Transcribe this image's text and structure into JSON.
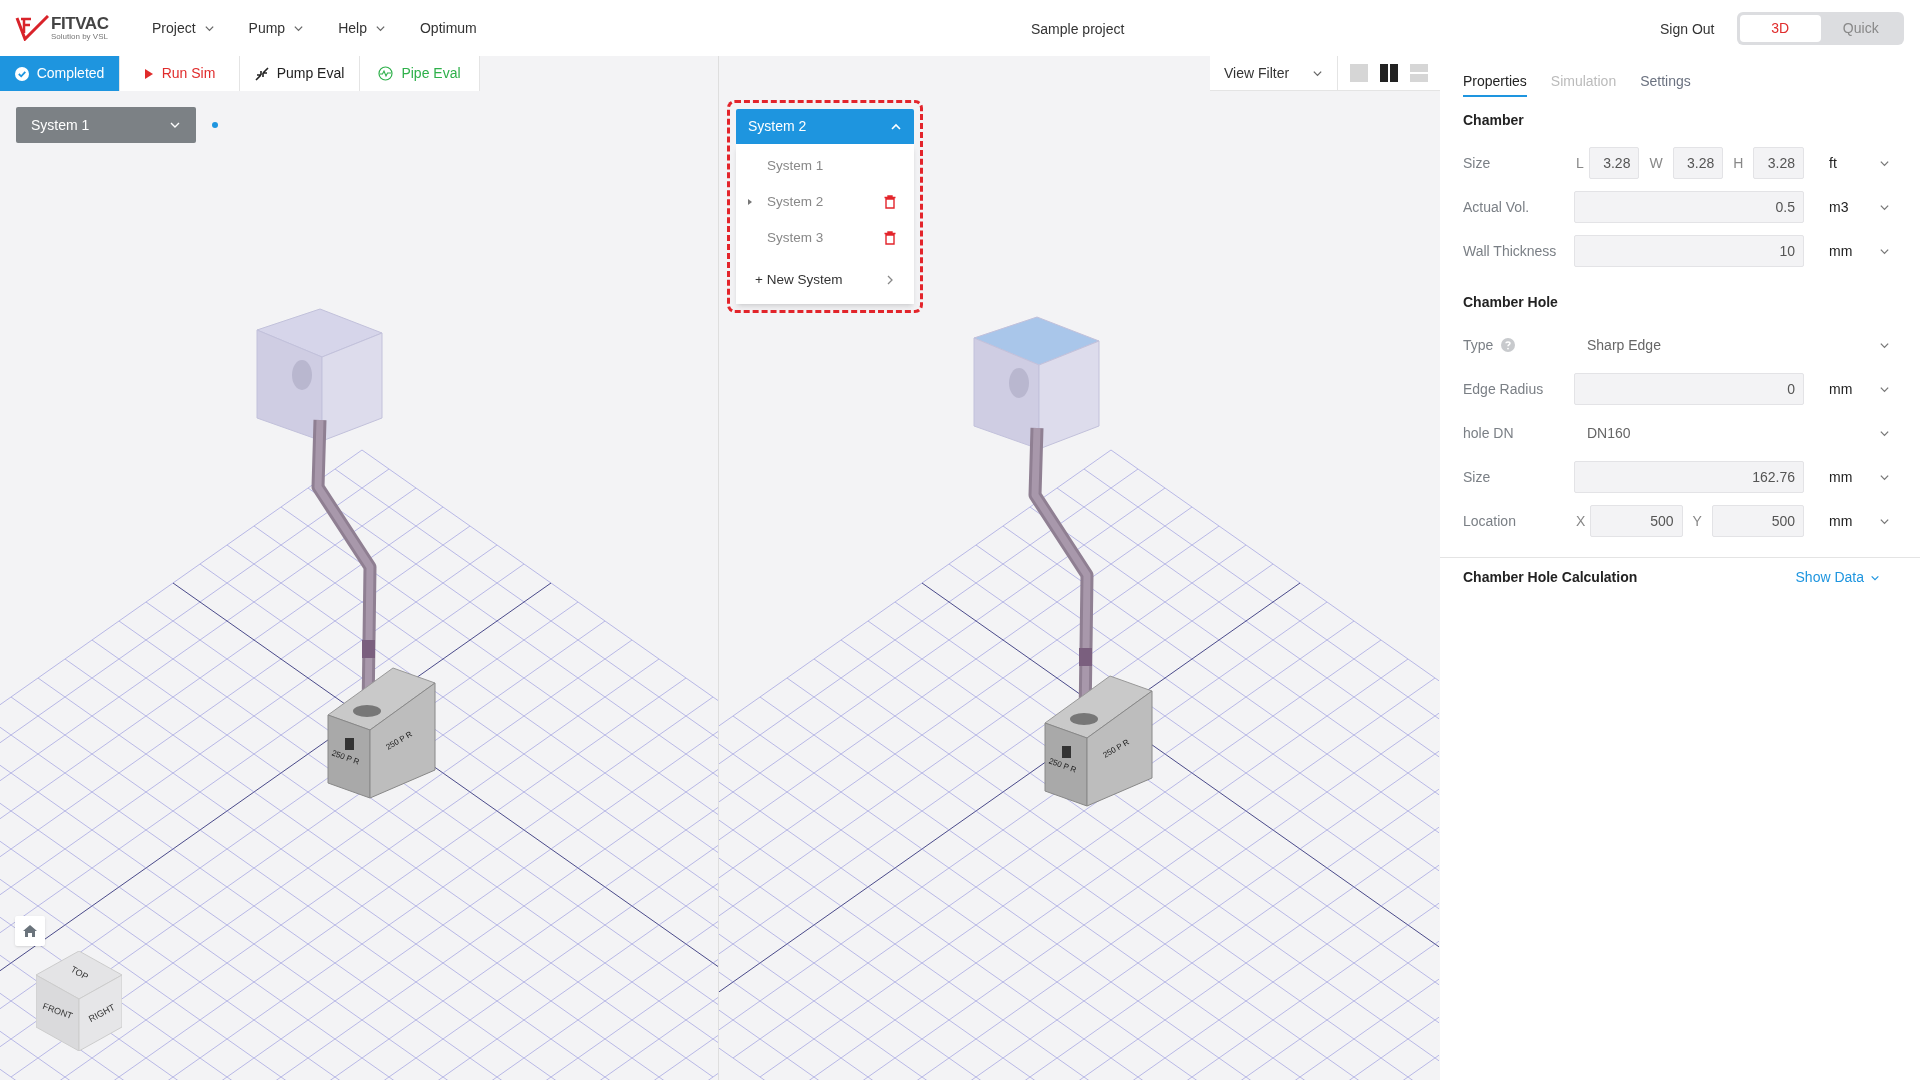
{
  "header": {
    "logo": {
      "name": "FITVAC",
      "tagline": "Solution by VSL"
    },
    "menu": [
      {
        "label": "Project",
        "has_caret": true
      },
      {
        "label": "Pump",
        "has_caret": true
      },
      {
        "label": "Help",
        "has_caret": true
      },
      {
        "label": "Optimum",
        "has_caret": false
      }
    ],
    "project_title": "Sample project",
    "sign_out": "Sign Out",
    "mode_toggle": [
      {
        "label": "3D",
        "selected": true
      },
      {
        "label": "Quick",
        "selected": false
      }
    ]
  },
  "toolbar": [
    {
      "label": "Completed",
      "kind": "status"
    },
    {
      "label": "Run Sim",
      "kind": "run"
    },
    {
      "label": "Pump Eval",
      "kind": "pump"
    },
    {
      "label": "Pipe Eval",
      "kind": "pipe"
    }
  ],
  "left_view": {
    "system_select": "System 1",
    "pump_labels": [
      "250 P R",
      "250 P R"
    ],
    "view_cube": [
      "TOP",
      "FRONT",
      "RIGHT"
    ]
  },
  "right_view": {
    "view_filter": "View Filter",
    "layouts": [
      {
        "kind": "single",
        "selected": false
      },
      {
        "kind": "columns",
        "selected": true
      },
      {
        "kind": "rows",
        "selected": false
      }
    ],
    "system_dropdown": {
      "value": "System 2",
      "expanded": true,
      "items": [
        {
          "label": "System 1",
          "selected": false,
          "deletable": false
        },
        {
          "label": "System 2",
          "selected": true,
          "deletable": true
        },
        {
          "label": "System 3",
          "selected": false,
          "deletable": true
        }
      ],
      "new_item": "+ New System"
    },
    "pump_labels": [
      "250 P R",
      "250 P R"
    ]
  },
  "panel": {
    "tabs": [
      {
        "label": "Properties",
        "selected": true,
        "disabled": false
      },
      {
        "label": "Simulation",
        "selected": false,
        "disabled": true
      },
      {
        "label": "Settings",
        "selected": false,
        "disabled": false
      }
    ],
    "sections": [
      {
        "title": "Chamber",
        "rows": [
          {
            "label": "Size",
            "kind": "multi",
            "fields": [
              {
                "prefix": "L",
                "value": "3.28"
              },
              {
                "prefix": "W",
                "value": "3.28"
              },
              {
                "prefix": "H",
                "value": "3.28"
              }
            ],
            "unit": "ft"
          },
          {
            "label": "Actual Vol.",
            "kind": "input",
            "value": "0.5",
            "unit": "m3"
          },
          {
            "label": "Wall Thickness",
            "kind": "input",
            "value": "10",
            "unit": "mm"
          }
        ]
      },
      {
        "title": "Chamber Hole",
        "rows": [
          {
            "label": "Type",
            "kind": "select",
            "help": true,
            "value": "Sharp Edge"
          },
          {
            "label": "Edge Radius",
            "kind": "input",
            "value": "0",
            "unit": "mm"
          },
          {
            "label": "hole DN",
            "kind": "select",
            "value": "DN160"
          },
          {
            "label": "Size",
            "kind": "input",
            "value": "162.76",
            "unit": "mm"
          },
          {
            "label": "Location",
            "kind": "multi",
            "fields": [
              {
                "prefix": "X",
                "value": "500"
              },
              {
                "prefix": "Y",
                "value": "500"
              }
            ],
            "unit": "mm"
          }
        ]
      }
    ],
    "calculation": {
      "title": "Chamber Hole Calculation",
      "action": "Show Data"
    }
  }
}
